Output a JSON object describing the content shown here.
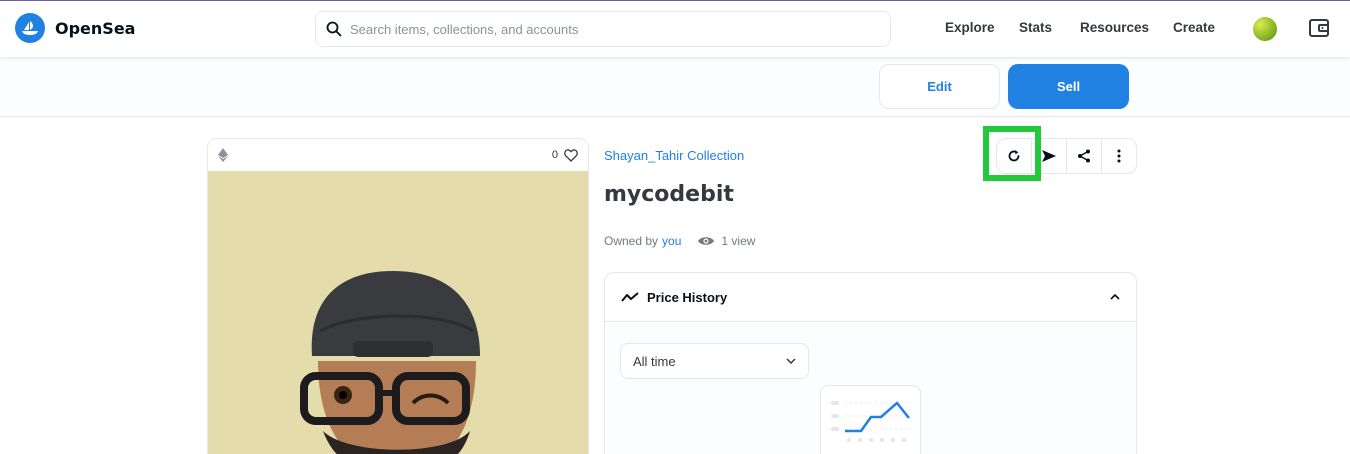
{
  "header": {
    "brand": "OpenSea",
    "search_placeholder": "Search items, collections, and accounts",
    "nav": [
      "Explore",
      "Stats",
      "Resources",
      "Create"
    ]
  },
  "actions": {
    "edit_label": "Edit",
    "sell_label": "Sell"
  },
  "item": {
    "favorites_count": "0",
    "collection": "Shayan_Tahir Collection",
    "name": "mycodebit",
    "owned_by_label": "Owned by",
    "owner": "you",
    "views": "1 view"
  },
  "price_history": {
    "title": "Price History",
    "range_selected": "All time"
  },
  "colors": {
    "accent": "#2081e2",
    "highlight": "#22c93a",
    "art_background": "#e4dcab"
  },
  "icons": [
    "opensea-logo-icon",
    "search-icon",
    "account-avatar-icon",
    "wallet-icon",
    "ethereum-icon",
    "heart-icon",
    "refresh-icon",
    "send-icon",
    "share-icon",
    "more-icon",
    "eye-icon",
    "trending-icon",
    "chevron-up-icon",
    "chevron-down-icon"
  ]
}
